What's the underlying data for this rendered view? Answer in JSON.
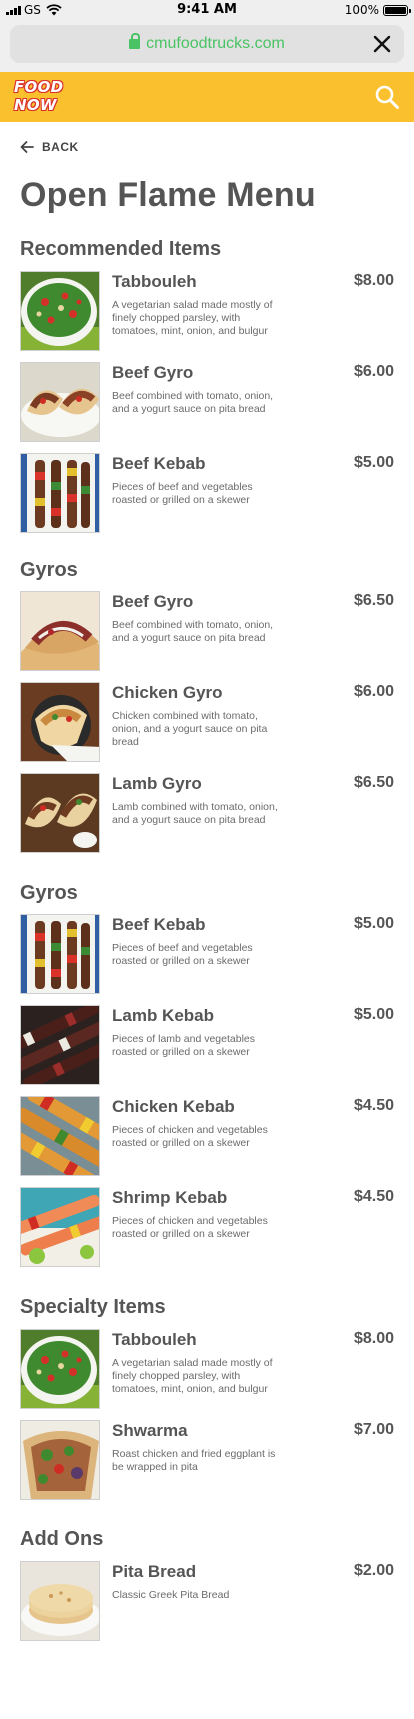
{
  "status_bar": {
    "carrier": "GS",
    "time": "9:41 AM",
    "battery_text": "100%",
    "battery_level": 1.0
  },
  "browser": {
    "url": "cmufoodtrucks.com",
    "close_icon": "close-icon",
    "lock_icon": "lock-icon",
    "url_color": "#49c364"
  },
  "header": {
    "logo_line1": "FOOD",
    "logo_line2": "NOW",
    "background_color": "#fbc02d",
    "search_icon": "search-icon"
  },
  "nav": {
    "back_label": "BACK",
    "back_icon": "arrow-left-icon"
  },
  "page": {
    "title": "Open Flame Menu"
  },
  "sections": [
    {
      "title": "Recommended Items",
      "items": [
        {
          "name": "Tabbouleh",
          "price": "$8.00",
          "description": "A vegetarian salad made mostly of finely chopped parsley, with tomatoes, mint, onion, and bulgur"
        },
        {
          "name": "Beef Gyro",
          "price": "$6.00",
          "description": "Beef combined with tomato, onion, and a yogurt sauce on pita bread"
        },
        {
          "name": "Beef Kebab",
          "price": "$5.00",
          "description": "Pieces of beef and vegetables roasted or grilled on a skewer"
        }
      ]
    },
    {
      "title": "Gyros",
      "items": [
        {
          "name": "Beef Gyro",
          "price": "$6.50",
          "description": "Beef combined with tomato, onion, and a yogurt sauce on pita bread"
        },
        {
          "name": "Chicken Gyro",
          "price": "$6.00",
          "description": "Chicken combined with tomato, onion, and a yogurt sauce on pita bread"
        },
        {
          "name": "Lamb Gyro",
          "price": "$6.50",
          "description": "Lamb combined with tomato, onion, and a yogurt sauce on pita bread"
        }
      ]
    },
    {
      "title": "Gyros",
      "items": [
        {
          "name": "Beef Kebab",
          "price": "$5.00",
          "description": "Pieces of beef and vegetables roasted or grilled on a skewer"
        },
        {
          "name": "Lamb Kebab",
          "price": "$5.00",
          "description": "Pieces of lamb and vegetables roasted or grilled on a skewer"
        },
        {
          "name": "Chicken Kebab",
          "price": "$4.50",
          "description": "Pieces of chicken and vegetables roasted or grilled on a skewer"
        },
        {
          "name": "Shrimp Kebab",
          "price": "$4.50",
          "description": "Pieces of chicken and vegetables roasted or grilled on a skewer"
        }
      ]
    },
    {
      "title": "Specialty Items",
      "items": [
        {
          "name": "Tabbouleh",
          "price": "$8.00",
          "description": "A vegetarian salad made mostly of finely chopped parsley, with tomatoes, mint, onion, and bulgur"
        },
        {
          "name": "Shwarma",
          "price": "$7.00",
          "description": "Roast chicken and fried eggplant is be wrapped in pita"
        }
      ]
    },
    {
      "title": "Add Ons",
      "items": [
        {
          "name": "Pita Bread",
          "price": "$2.00",
          "description": "Classic Greek Pita Bread"
        }
      ]
    }
  ]
}
